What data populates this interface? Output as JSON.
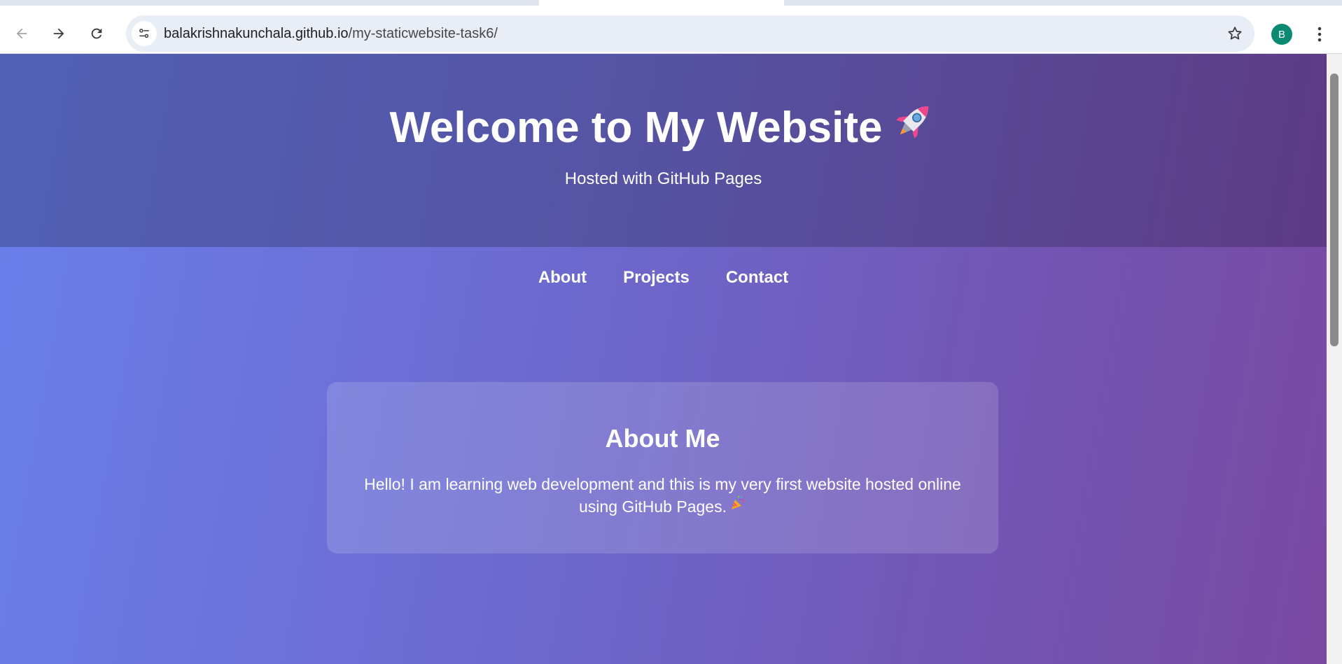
{
  "browser": {
    "url_domain": "balakrishnakunchala.github.io",
    "url_path": "/my-staticwebsite-task6/",
    "profile_initial": "B",
    "profile_color": "#0b8a73",
    "icons": [
      "back-icon",
      "forward-icon",
      "reload-icon",
      "site-info-icon",
      "bookmark-star-icon",
      "kebab-menu-icon"
    ]
  },
  "hero": {
    "title": "Welcome to My Website",
    "title_icon": "rocket-icon",
    "subtitle": "Hosted with GitHub Pages"
  },
  "nav": {
    "items": [
      {
        "label": "About"
      },
      {
        "label": "Projects"
      },
      {
        "label": "Contact"
      }
    ]
  },
  "about": {
    "title": "About Me",
    "text": "Hello! I am learning web development and this is my very first website hosted online using GitHub Pages.",
    "text_icon": "party-popper-icon"
  },
  "colors": {
    "hero_bg_start": "#5061b5",
    "hero_bg_end": "#5e3a84",
    "page_bg_start": "#6a7fec",
    "page_bg_end": "#7a4aa2"
  }
}
